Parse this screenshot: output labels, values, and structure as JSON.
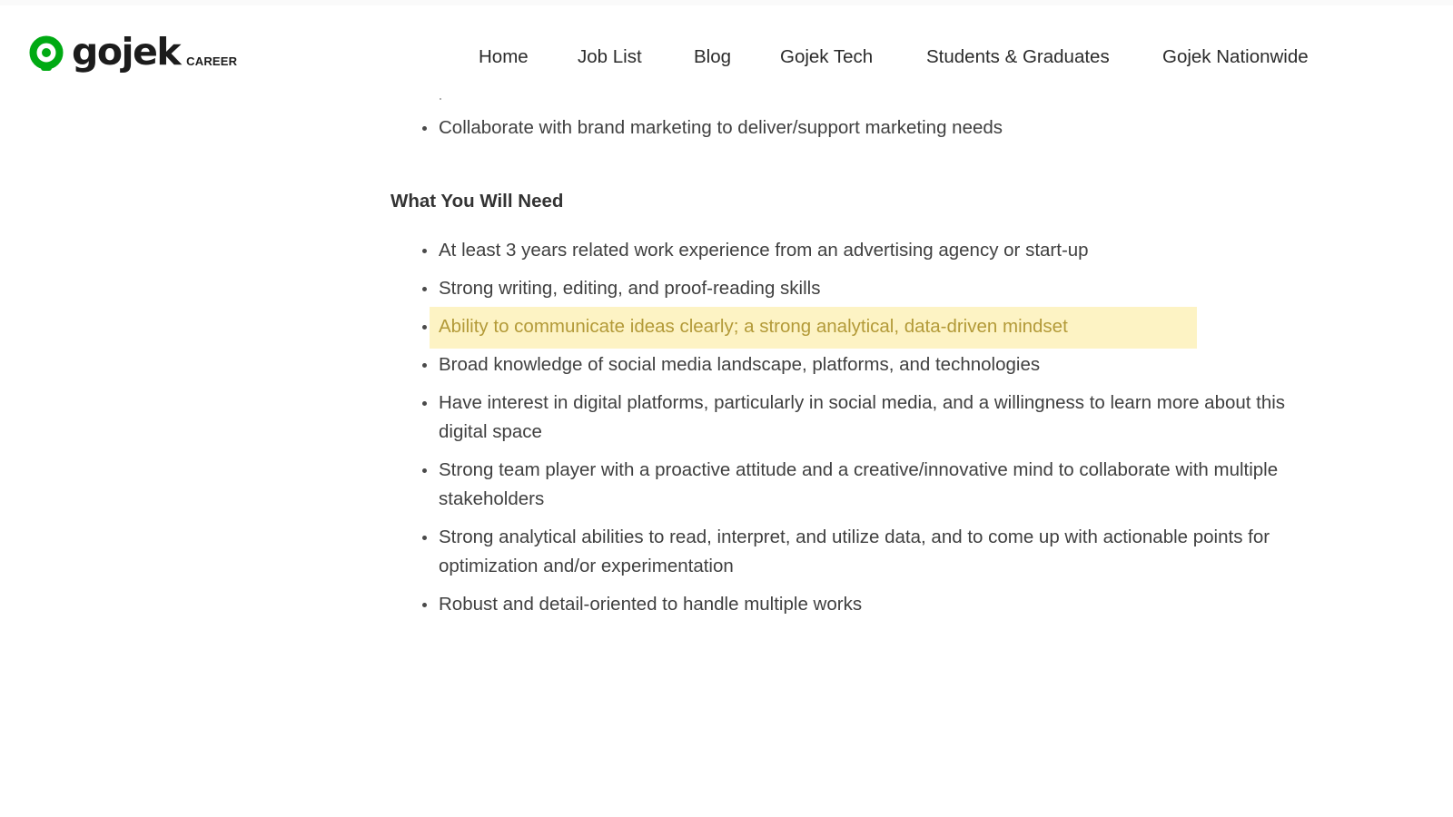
{
  "brand": {
    "wordmark": "gojek",
    "subtitle": "CAREER",
    "accent_color": "#00aa13"
  },
  "nav": {
    "items": [
      {
        "label": "Home"
      },
      {
        "label": "Job List"
      },
      {
        "label": "Blog"
      },
      {
        "label": "Gojek Tech"
      },
      {
        "label": "Students & Graduates"
      },
      {
        "label": "Gojek Nationwide"
      }
    ]
  },
  "content": {
    "previous_items": [
      "Collaborate with brand marketing to deliver/support marketing needs"
    ],
    "requirements": {
      "heading": "What You Will Need",
      "items": [
        "At least 3 years related work experience from an advertising agency or start-up",
        "Strong writing, editing, and proof-reading skills",
        "Ability to communicate ideas clearly; a strong analytical, data-driven mindset",
        "Broad knowledge of social media landscape, platforms, and technologies",
        "Have interest in digital platforms, particularly in social media, and a willingness to learn more about this digital space",
        "Strong team player with a proactive attitude and a creative/innovative mind to collaborate with multiple stakeholders",
        "Strong analytical abilities to read, interpret, and utilize data, and to come up with actionable points for optimization and/or experimentation",
        "Robust and detail-oriented to handle multiple works"
      ]
    },
    "highlight_color": "#fdf3c4"
  }
}
